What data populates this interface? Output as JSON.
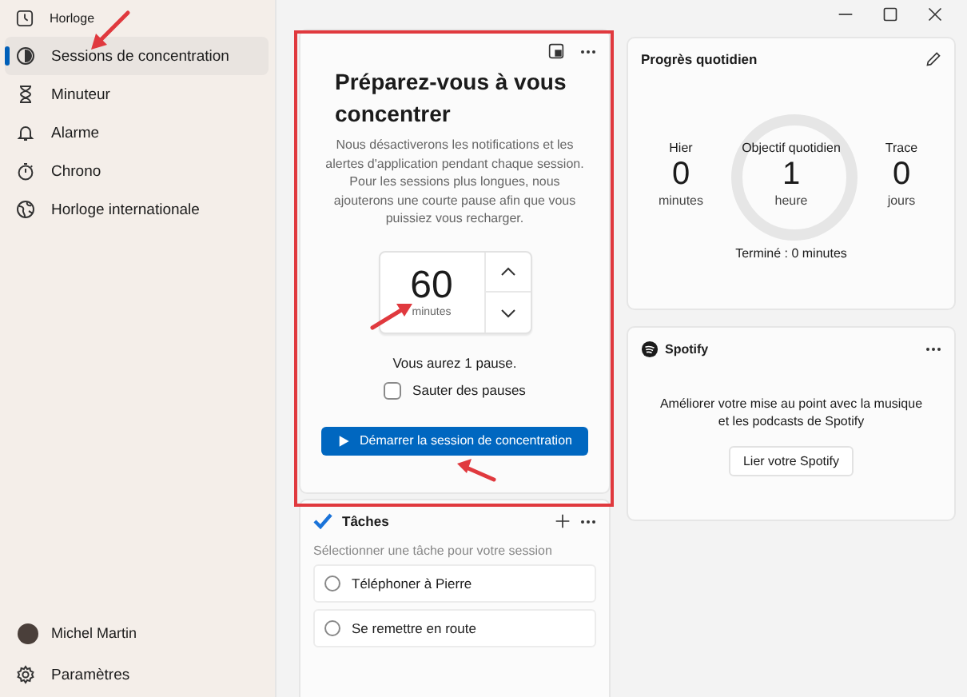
{
  "window": {
    "title": "Horloge"
  },
  "sidebar": {
    "items": [
      {
        "label": "Sessions de concentration",
        "selected": true
      },
      {
        "label": "Minuteur",
        "selected": false
      },
      {
        "label": "Alarme",
        "selected": false
      },
      {
        "label": "Chrono",
        "selected": false
      },
      {
        "label": "Horloge internationale",
        "selected": false
      }
    ],
    "account": {
      "name": "Michel Martin"
    },
    "settings": {
      "label": "Paramètres"
    }
  },
  "focus": {
    "title": "Préparez-vous à vous concentrer",
    "description": "Nous désactiverons les notifications et les alertes d'application pendant chaque session. Pour les sessions plus longues, nous ajouterons une courte pause afin que vous puissiez vous recharger.",
    "timer": {
      "value": "60",
      "unit": "minutes"
    },
    "breaks_note": "Vous aurez 1 pause.",
    "skip_breaks": {
      "label": "Sauter des pauses",
      "checked": false
    },
    "start_button": "Démarrer la session de concentration"
  },
  "tasks": {
    "title": "Tâches",
    "hint": "Sélectionner une tâche pour votre session",
    "items": [
      {
        "label": "Téléphoner à Pierre",
        "checked": false
      },
      {
        "label": "Se remettre en route",
        "checked": false
      }
    ]
  },
  "progress": {
    "title": "Progrès quotidien",
    "stats": [
      {
        "label": "Hier",
        "value": "0",
        "unit": "minutes"
      },
      {
        "label": "Objectif quotidien",
        "value": "1",
        "unit": "heure"
      },
      {
        "label": "Trace",
        "value": "0",
        "unit": "jours"
      }
    ],
    "completed": "Terminé : 0 minutes"
  },
  "spotify": {
    "title": "Spotify",
    "description": "Améliorer votre mise au point avec la musique et les podcasts de Spotify",
    "button": "Lier votre Spotify"
  }
}
